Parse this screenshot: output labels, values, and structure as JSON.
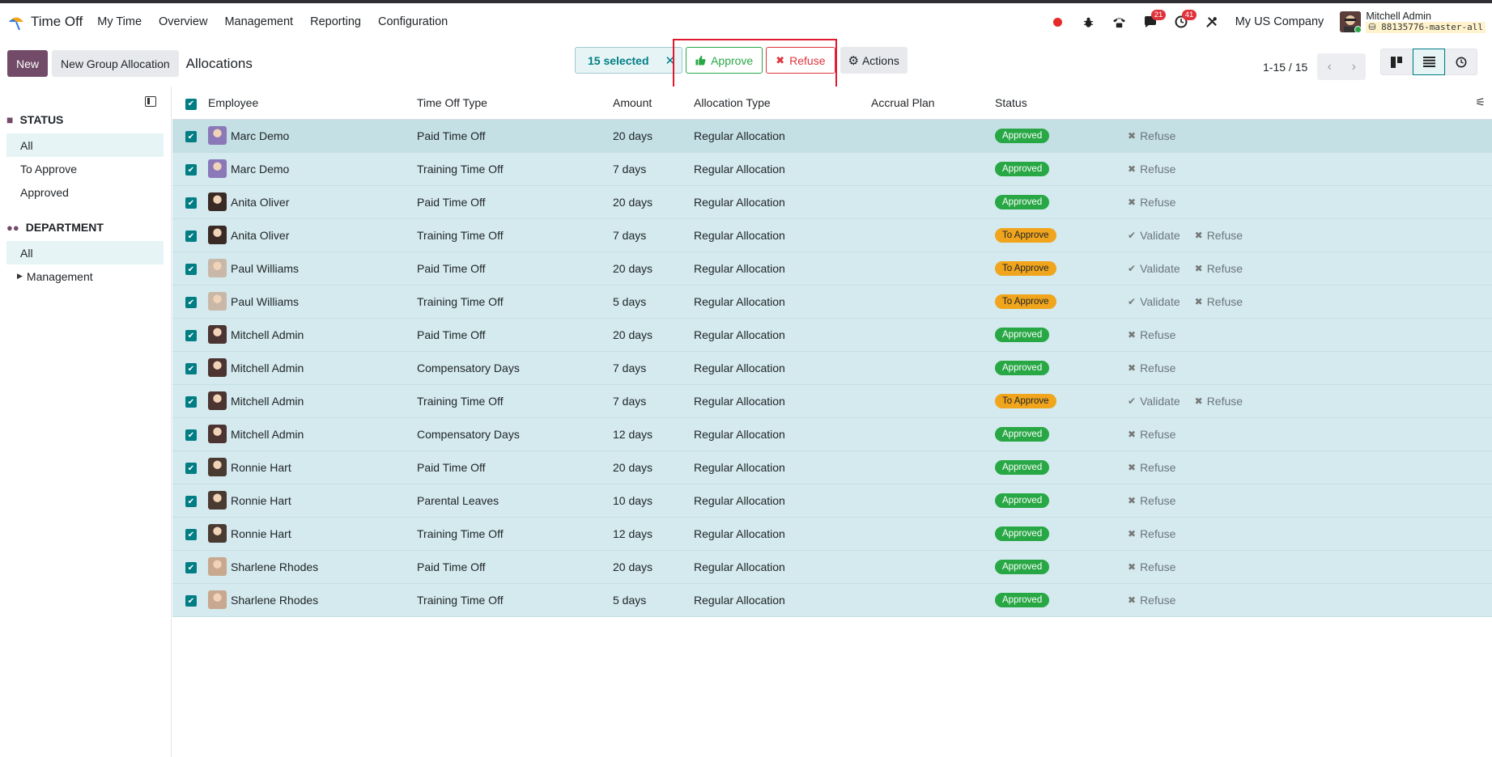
{
  "app": {
    "name": "Time Off",
    "menu": [
      "My Time",
      "Overview",
      "Management",
      "Reporting",
      "Configuration"
    ],
    "company": "My US Company",
    "user": "Mitchell Admin",
    "database": "88135776-master-all",
    "messages_count": "21",
    "activities_count": "41"
  },
  "control": {
    "new_label": "New",
    "group_label": "New Group Allocation",
    "breadcrumb": "Allocations",
    "selected_label": "15 selected",
    "approve_label": "Approve",
    "refuse_label": "Refuse",
    "actions_label": "Actions",
    "pager": "1-15 / 15"
  },
  "sidebar": {
    "status_title": "STATUS",
    "status_items": [
      "All",
      "To Approve",
      "Approved"
    ],
    "department_title": "DEPARTMENT",
    "department_items": [
      "All",
      "Management"
    ]
  },
  "table": {
    "columns": [
      "Employee",
      "Time Off Type",
      "Amount",
      "Allocation Type",
      "Accrual Plan",
      "Status"
    ],
    "validate_label": "Validate",
    "refuse_label": "Refuse",
    "rows": [
      {
        "employee": "Marc Demo",
        "type": "Paid Time Off",
        "amount": "20 days",
        "alloc": "Regular Allocation",
        "status": "Approved",
        "avatar": "marc"
      },
      {
        "employee": "Marc Demo",
        "type": "Training Time Off",
        "amount": "7 days",
        "alloc": "Regular Allocation",
        "status": "Approved",
        "avatar": "marc"
      },
      {
        "employee": "Anita Oliver",
        "type": "Paid Time Off",
        "amount": "20 days",
        "alloc": "Regular Allocation",
        "status": "Approved",
        "avatar": "anita"
      },
      {
        "employee": "Anita Oliver",
        "type": "Training Time Off",
        "amount": "7 days",
        "alloc": "Regular Allocation",
        "status": "To Approve",
        "avatar": "anita"
      },
      {
        "employee": "Paul Williams",
        "type": "Paid Time Off",
        "amount": "20 days",
        "alloc": "Regular Allocation",
        "status": "To Approve",
        "avatar": "paul"
      },
      {
        "employee": "Paul Williams",
        "type": "Training Time Off",
        "amount": "5 days",
        "alloc": "Regular Allocation",
        "status": "To Approve",
        "avatar": "paul"
      },
      {
        "employee": "Mitchell Admin",
        "type": "Paid Time Off",
        "amount": "20 days",
        "alloc": "Regular Allocation",
        "status": "Approved",
        "avatar": "mitchell"
      },
      {
        "employee": "Mitchell Admin",
        "type": "Compensatory Days",
        "amount": "7 days",
        "alloc": "Regular Allocation",
        "status": "Approved",
        "avatar": "mitchell"
      },
      {
        "employee": "Mitchell Admin",
        "type": "Training Time Off",
        "amount": "7 days",
        "alloc": "Regular Allocation",
        "status": "To Approve",
        "avatar": "mitchell"
      },
      {
        "employee": "Mitchell Admin",
        "type": "Compensatory Days",
        "amount": "12 days",
        "alloc": "Regular Allocation",
        "status": "Approved",
        "avatar": "mitchell"
      },
      {
        "employee": "Ronnie Hart",
        "type": "Paid Time Off",
        "amount": "20 days",
        "alloc": "Regular Allocation",
        "status": "Approved",
        "avatar": "ronnie"
      },
      {
        "employee": "Ronnie Hart",
        "type": "Parental Leaves",
        "amount": "10 days",
        "alloc": "Regular Allocation",
        "status": "Approved",
        "avatar": "ronnie"
      },
      {
        "employee": "Ronnie Hart",
        "type": "Training Time Off",
        "amount": "12 days",
        "alloc": "Regular Allocation",
        "status": "Approved",
        "avatar": "ronnie"
      },
      {
        "employee": "Sharlene Rhodes",
        "type": "Paid Time Off",
        "amount": "20 days",
        "alloc": "Regular Allocation",
        "status": "Approved",
        "avatar": "sharlene"
      },
      {
        "employee": "Sharlene Rhodes",
        "type": "Training Time Off",
        "amount": "5 days",
        "alloc": "Regular Allocation",
        "status": "Approved",
        "avatar": "sharlene"
      }
    ]
  },
  "colors": {
    "brand": "#714b67",
    "teal": "#017e84",
    "approved": "#28a745",
    "to_approve": "#f0a51c",
    "refuse": "#e0323b",
    "highlight": "#e0182e"
  },
  "avatar_colors": {
    "marc": "#8a78b8",
    "anita": "#3a2a25",
    "paul": "#c9b8a8",
    "mitchell": "#4b3431",
    "ronnie": "#4a3b32",
    "sharlene": "#c8a88e"
  }
}
